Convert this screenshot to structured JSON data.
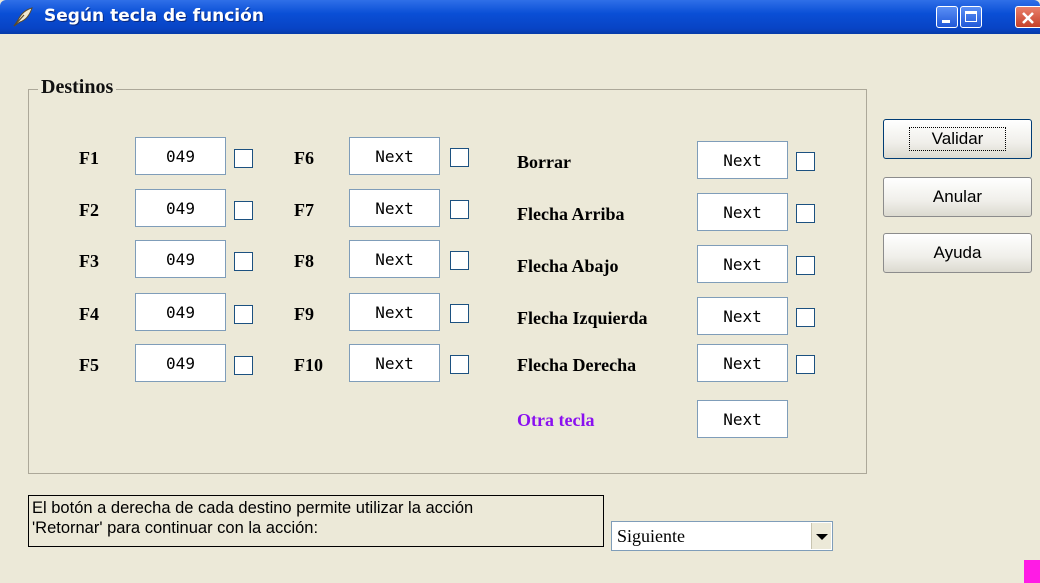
{
  "window": {
    "title": "Según tecla de función"
  },
  "destinos": {
    "legend": "Destinos",
    "f_left": [
      {
        "key": "F1",
        "value": "049"
      },
      {
        "key": "F2",
        "value": "049"
      },
      {
        "key": "F3",
        "value": "049"
      },
      {
        "key": "F4",
        "value": "049"
      },
      {
        "key": "F5",
        "value": "049"
      }
    ],
    "f_mid": [
      {
        "key": "F6",
        "value": "Next"
      },
      {
        "key": "F7",
        "value": "Next"
      },
      {
        "key": "F8",
        "value": "Next"
      },
      {
        "key": "F9",
        "value": "Next"
      },
      {
        "key": "F10",
        "value": "Next"
      }
    ],
    "arrows": [
      {
        "key": "Borrar",
        "value": "Next"
      },
      {
        "key": "Flecha Arriba",
        "value": "Next"
      },
      {
        "key": "Flecha Abajo",
        "value": "Next"
      },
      {
        "key": "Flecha Izquierda",
        "value": "Next"
      },
      {
        "key": "Flecha Derecha",
        "value": "Next"
      }
    ],
    "otra": {
      "key": "Otra tecla",
      "value": "Next",
      "color": "#8a10f0"
    }
  },
  "buttons": {
    "validar": "Validar",
    "anular": "Anular",
    "ayuda": "Ayuda"
  },
  "info": {
    "line1": "El botón a derecha de cada destino permite utilizar la acción",
    "line2": "'Retornar' para continuar con la acción:"
  },
  "action_select": {
    "value": "Siguiente"
  },
  "colors": {
    "titlebar": "#0a4fd6",
    "background": "#ece9d8",
    "accent_otra": "#8a10f0"
  }
}
